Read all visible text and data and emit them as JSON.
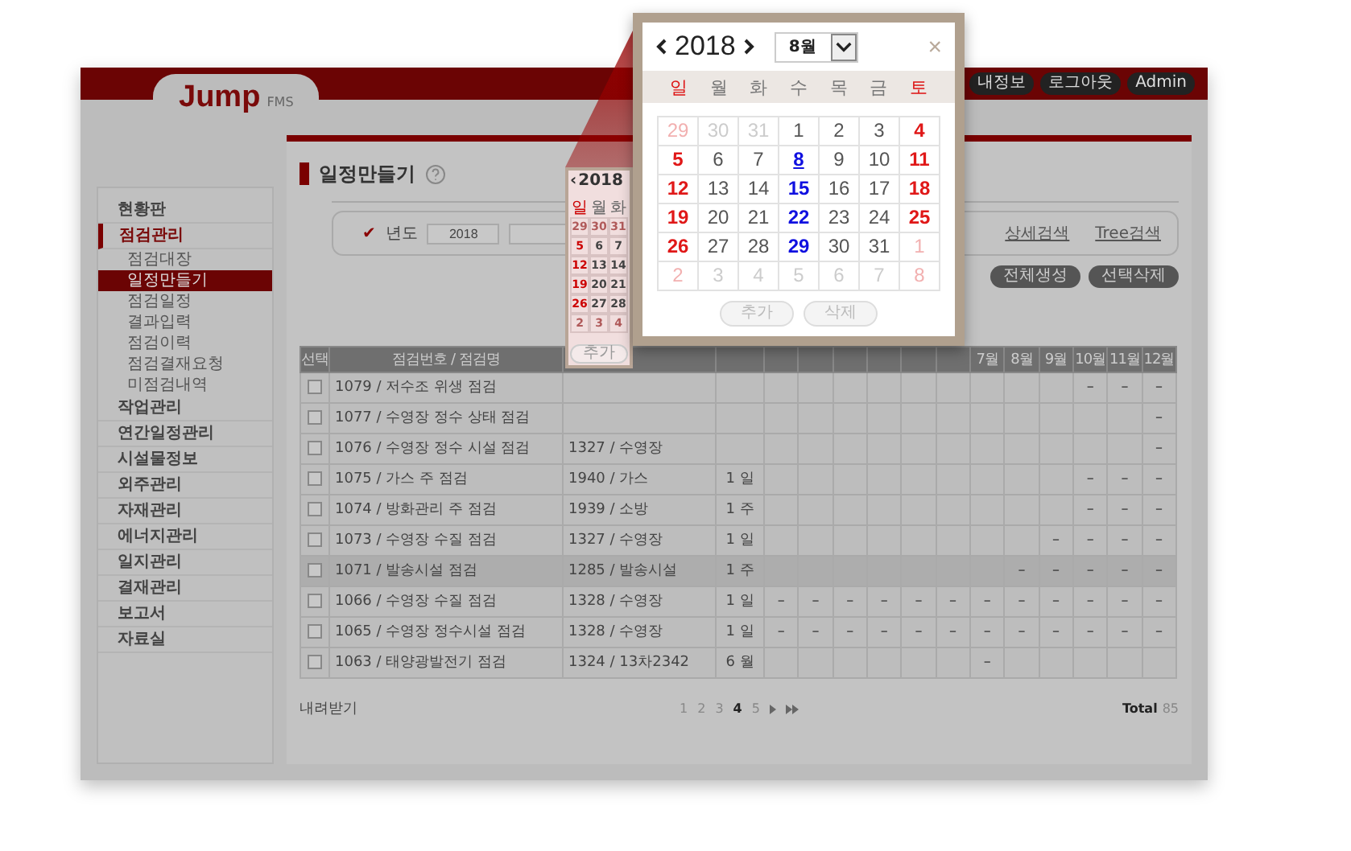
{
  "header": {
    "logo": "Jump",
    "logo_suffix": "FMS",
    "buttons": [
      "내정보",
      "로그아웃",
      "Admin"
    ]
  },
  "sidebar": {
    "items": [
      {
        "label": "현황판",
        "selected": false
      },
      {
        "label": "점검관리",
        "selected": true,
        "children": [
          {
            "label": "점검대장",
            "selected": false
          },
          {
            "label": "일정만들기",
            "selected": true
          },
          {
            "label": "점검일정",
            "selected": false
          },
          {
            "label": "결과입력",
            "selected": false
          },
          {
            "label": "점검이력",
            "selected": false
          },
          {
            "label": "점검결재요청",
            "selected": false
          },
          {
            "label": "미점검내역",
            "selected": false
          }
        ]
      },
      {
        "label": "작업관리",
        "selected": false
      },
      {
        "label": "연간일정관리",
        "selected": false
      },
      {
        "label": "시설물정보",
        "selected": false
      },
      {
        "label": "외주관리",
        "selected": false
      },
      {
        "label": "자재관리",
        "selected": false
      },
      {
        "label": "에너지관리",
        "selected": false
      },
      {
        "label": "일지관리",
        "selected": false
      },
      {
        "label": "결재관리",
        "selected": false
      },
      {
        "label": "보고서",
        "selected": false
      },
      {
        "label": "자료실",
        "selected": false
      }
    ]
  },
  "page_title": "일정만들기",
  "filter": {
    "check_mark": "✔",
    "label": "년도",
    "year_value": "2018",
    "links": [
      "상세검색",
      "Tree검색"
    ]
  },
  "actions": [
    "전체생성",
    "선택삭제"
  ],
  "table": {
    "columns": [
      "선택",
      "점검번호 / 점검명"
    ],
    "month_columns": [
      "7월",
      "8월",
      "9월",
      "10월",
      "11월",
      "12월"
    ],
    "mark": "–",
    "rows": [
      {
        "checked": false,
        "selected": false,
        "name": "1079 / 저수조 위생 점검",
        "months": [
          false,
          false,
          false,
          false,
          false,
          false,
          false,
          false,
          false,
          true,
          true,
          true
        ]
      },
      {
        "checked": false,
        "selected": false,
        "name": "1077 / 수영장 정수 상태 점검",
        "months": [
          false,
          false,
          false,
          false,
          false,
          false,
          false,
          false,
          false,
          false,
          false,
          true
        ]
      },
      {
        "checked": false,
        "selected": false,
        "name": "1076 / 수영장 정수 시설 점검",
        "facility": "1327 / 수영장",
        "months": [
          false,
          false,
          false,
          false,
          false,
          false,
          false,
          false,
          false,
          false,
          false,
          true
        ]
      },
      {
        "checked": false,
        "selected": false,
        "name": "1075 / 가스 주 점검",
        "facility": "1940 / 가스",
        "cycle": "1 일",
        "months": [
          false,
          false,
          false,
          false,
          false,
          false,
          false,
          false,
          false,
          true,
          true,
          true
        ]
      },
      {
        "checked": false,
        "selected": false,
        "name": "1074 / 방화관리 주 점검",
        "facility": "1939 / 소방",
        "cycle": "1 주",
        "months": [
          false,
          false,
          false,
          false,
          false,
          false,
          false,
          false,
          false,
          true,
          true,
          true
        ]
      },
      {
        "checked": false,
        "selected": false,
        "name": "1073 / 수영장 수질 점검",
        "facility": "1327 / 수영장",
        "cycle": "1 일",
        "months": [
          false,
          false,
          false,
          false,
          false,
          false,
          false,
          false,
          true,
          true,
          true,
          true
        ]
      },
      {
        "checked": false,
        "selected": true,
        "name": "1071 / 발송시설 점검",
        "facility": "1285 / 발송시설",
        "cycle": "1 주",
        "months": [
          false,
          false,
          false,
          false,
          false,
          false,
          false,
          true,
          true,
          true,
          true,
          true
        ]
      },
      {
        "checked": false,
        "selected": false,
        "name": "1066 / 수영장 수질 점검",
        "facility": "1328 / 수영장",
        "cycle": "1 일",
        "months": [
          true,
          true,
          true,
          true,
          true,
          true,
          true,
          true,
          true,
          true,
          true,
          true
        ]
      },
      {
        "checked": false,
        "selected": false,
        "name": "1065 / 수영장 정수시설 점검",
        "facility": "1328 / 수영장",
        "cycle": "1 일",
        "months": [
          true,
          true,
          true,
          true,
          true,
          true,
          true,
          true,
          true,
          true,
          true,
          true
        ]
      },
      {
        "checked": false,
        "selected": false,
        "name": "1063 / 태양광발전기 점검",
        "facility": "1324 / 13차2342",
        "cycle": "6 월",
        "months": [
          false,
          false,
          false,
          false,
          false,
          false,
          true,
          false,
          false,
          false,
          false,
          false
        ]
      }
    ]
  },
  "footer": {
    "download": "내려받기",
    "pages": [
      {
        "label": "1",
        "selected": false
      },
      {
        "label": "2",
        "selected": false
      },
      {
        "label": "3",
        "selected": false
      },
      {
        "label": "4",
        "selected": true
      },
      {
        "label": "5",
        "selected": false
      }
    ],
    "total_label": "Total",
    "total": "85"
  },
  "small_calendar": {
    "prev": "‹",
    "year": "2018",
    "weekdays": [
      "일",
      "월",
      "화"
    ],
    "weeks": [
      [
        "29",
        "30",
        "31"
      ],
      [
        "5",
        "6",
        "7"
      ],
      [
        "12",
        "13",
        "14"
      ],
      [
        "19",
        "20",
        "21"
      ],
      [
        "26",
        "27",
        "28"
      ],
      [
        "2",
        "3",
        "4"
      ]
    ],
    "button": "추가"
  },
  "calendar": {
    "year": "2018",
    "month": "8월",
    "close": "×",
    "weekdays": [
      "일",
      "월",
      "화",
      "수",
      "목",
      "금",
      "토"
    ],
    "weeks": [
      [
        {
          "day": "29",
          "muted": true,
          "scheduled": false,
          "selected": false
        },
        {
          "day": "30",
          "muted": true,
          "scheduled": false,
          "selected": false
        },
        {
          "day": "31",
          "muted": true,
          "scheduled": false,
          "selected": false
        },
        {
          "day": "1",
          "muted": false,
          "scheduled": false,
          "selected": false
        },
        {
          "day": "2",
          "muted": false,
          "scheduled": false,
          "selected": false
        },
        {
          "day": "3",
          "muted": false,
          "scheduled": false,
          "selected": false
        },
        {
          "day": "4",
          "muted": false,
          "scheduled": false,
          "selected": false
        }
      ],
      [
        {
          "day": "5",
          "muted": false,
          "scheduled": false,
          "selected": false
        },
        {
          "day": "6",
          "muted": false,
          "scheduled": false,
          "selected": false
        },
        {
          "day": "7",
          "muted": false,
          "scheduled": false,
          "selected": false
        },
        {
          "day": "8",
          "muted": false,
          "scheduled": true,
          "selected": true
        },
        {
          "day": "9",
          "muted": false,
          "scheduled": false,
          "selected": false
        },
        {
          "day": "10",
          "muted": false,
          "scheduled": false,
          "selected": false
        },
        {
          "day": "11",
          "muted": false,
          "scheduled": false,
          "selected": false
        }
      ],
      [
        {
          "day": "12",
          "muted": false,
          "scheduled": false,
          "selected": false
        },
        {
          "day": "13",
          "muted": false,
          "scheduled": false,
          "selected": false
        },
        {
          "day": "14",
          "muted": false,
          "scheduled": false,
          "selected": false
        },
        {
          "day": "15",
          "muted": false,
          "scheduled": true,
          "selected": false
        },
        {
          "day": "16",
          "muted": false,
          "scheduled": false,
          "selected": false
        },
        {
          "day": "17",
          "muted": false,
          "scheduled": false,
          "selected": false
        },
        {
          "day": "18",
          "muted": false,
          "scheduled": false,
          "selected": false
        }
      ],
      [
        {
          "day": "19",
          "muted": false,
          "scheduled": false,
          "selected": false
        },
        {
          "day": "20",
          "muted": false,
          "scheduled": false,
          "selected": false
        },
        {
          "day": "21",
          "muted": false,
          "scheduled": false,
          "selected": false
        },
        {
          "day": "22",
          "muted": false,
          "scheduled": true,
          "selected": false
        },
        {
          "day": "23",
          "muted": false,
          "scheduled": false,
          "selected": false
        },
        {
          "day": "24",
          "muted": false,
          "scheduled": false,
          "selected": false
        },
        {
          "day": "25",
          "muted": false,
          "scheduled": false,
          "selected": false
        }
      ],
      [
        {
          "day": "26",
          "muted": false,
          "scheduled": false,
          "selected": false
        },
        {
          "day": "27",
          "muted": false,
          "scheduled": false,
          "selected": false
        },
        {
          "day": "28",
          "muted": false,
          "scheduled": false,
          "selected": false
        },
        {
          "day": "29",
          "muted": false,
          "scheduled": true,
          "selected": false
        },
        {
          "day": "30",
          "muted": false,
          "scheduled": false,
          "selected": false
        },
        {
          "day": "31",
          "muted": false,
          "scheduled": false,
          "selected": false
        },
        {
          "day": "1",
          "muted": true,
          "scheduled": false,
          "selected": false
        }
      ],
      [
        {
          "day": "2",
          "muted": true,
          "scheduled": false,
          "selected": false
        },
        {
          "day": "3",
          "muted": true,
          "scheduled": false,
          "selected": false
        },
        {
          "day": "4",
          "muted": true,
          "scheduled": false,
          "selected": false
        },
        {
          "day": "5",
          "muted": true,
          "scheduled": false,
          "selected": false
        },
        {
          "day": "6",
          "muted": true,
          "scheduled": false,
          "selected": false
        },
        {
          "day": "7",
          "muted": true,
          "scheduled": false,
          "selected": false
        },
        {
          "day": "8",
          "muted": true,
          "scheduled": false,
          "selected": false
        }
      ]
    ],
    "buttons": [
      "추가",
      "삭제"
    ]
  }
}
